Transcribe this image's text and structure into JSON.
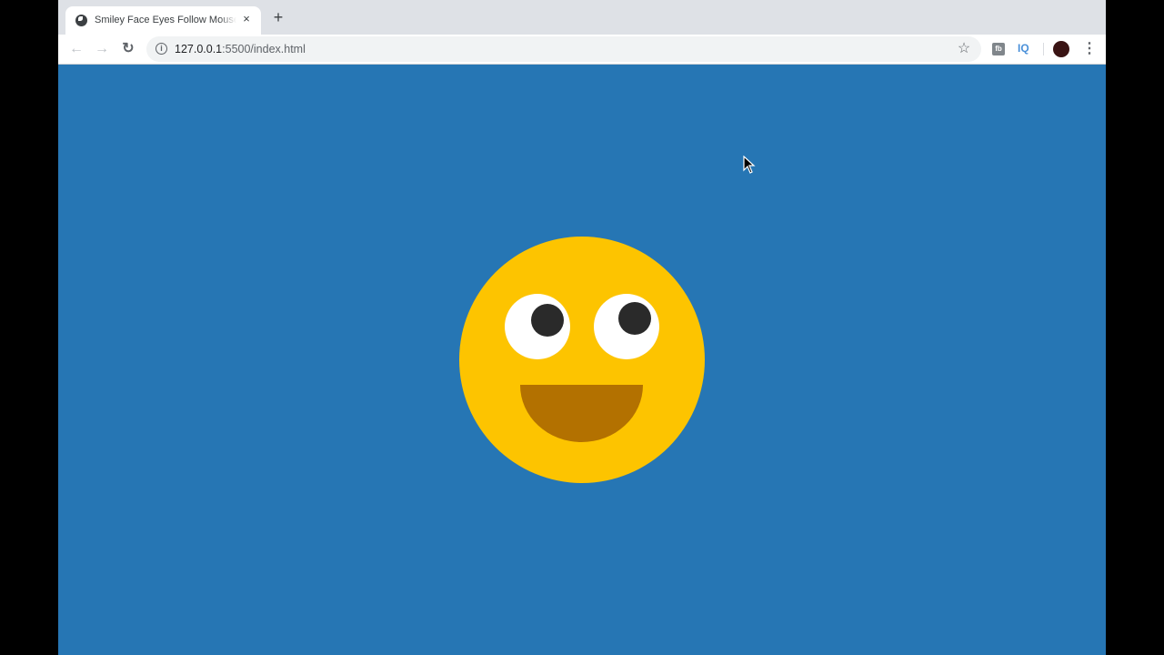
{
  "browser": {
    "tab": {
      "title": "Smiley Face Eyes Follow Mouse Effect",
      "favicon": "globe-icon",
      "close_label": "×"
    },
    "new_tab_label": "+",
    "nav": {
      "back_icon": "←",
      "forward_icon": "→",
      "reload_icon": "↻"
    },
    "address_bar": {
      "info_icon": "i",
      "url_host": "127.0.0.1",
      "url_rest": ":5500/index.html"
    },
    "bookmark_icon": "☆",
    "extensions": [
      {
        "name": "fb-extension",
        "label": "fb"
      },
      {
        "name": "iq-extension",
        "label": "IQ"
      }
    ],
    "menu_icon": "⋮"
  },
  "page": {
    "background_color": "#2676b4",
    "smiley": {
      "face_color": "#fdc400",
      "eye_color": "#ffffff",
      "pupil_color": "#2a2a2a",
      "mouth_color": "#b37100"
    }
  }
}
